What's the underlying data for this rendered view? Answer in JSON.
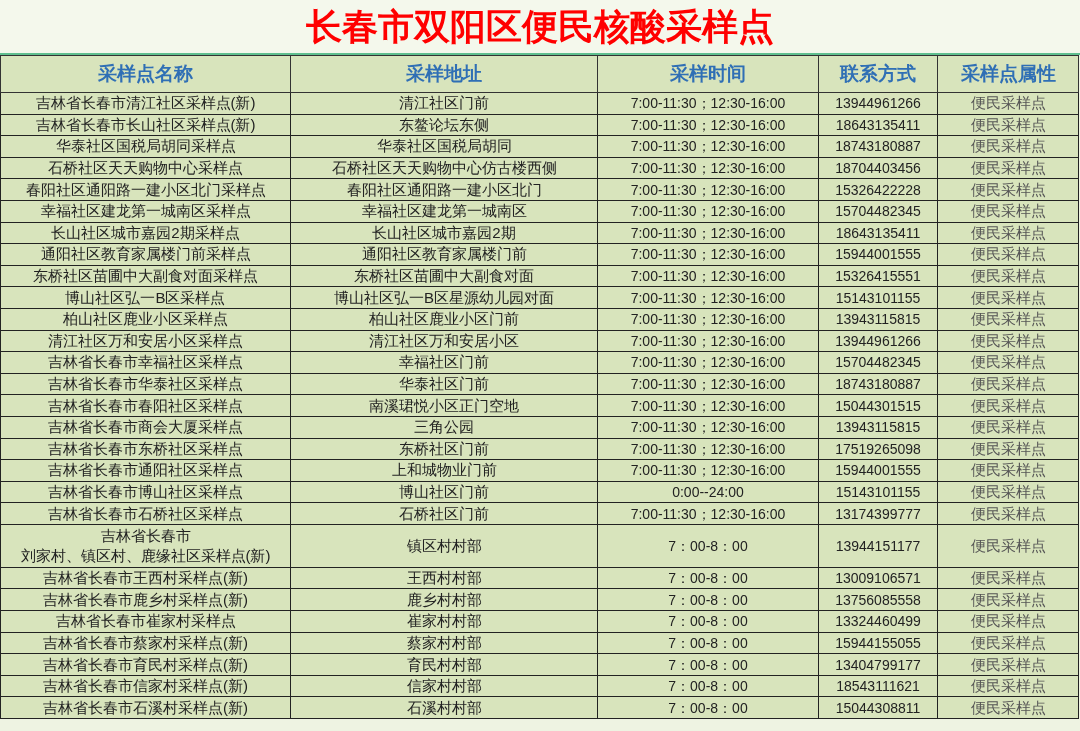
{
  "title": "长春市双阳区便民核酸采样点",
  "columns": [
    "采样点名称",
    "采样地址",
    "采样时间",
    "联系方式",
    "采样点属性"
  ],
  "rows": [
    [
      "吉林省长春市清江社区采样点(新)",
      "清江社区门前",
      "7:00-11:30；12:30-16:00",
      "13944961266",
      "便民采样点"
    ],
    [
      "吉林省长春市长山社区采样点(新)",
      "东鳌论坛东侧",
      "7:00-11:30；12:30-16:00",
      "18643135411",
      "便民采样点"
    ],
    [
      "华泰社区国税局胡同采样点",
      "华泰社区国税局胡同",
      "7:00-11:30；12:30-16:00",
      "18743180887",
      "便民采样点"
    ],
    [
      "石桥社区天天购物中心采样点",
      "石桥社区天天购物中心仿古楼西侧",
      "7:00-11:30；12:30-16:00",
      "18704403456",
      "便民采样点"
    ],
    [
      "春阳社区通阳路一建小区北门采样点",
      "春阳社区通阳路一建小区北门",
      "7:00-11:30；12:30-16:00",
      "15326422228",
      "便民采样点"
    ],
    [
      "幸福社区建龙第一城南区采样点",
      "幸福社区建龙第一城南区",
      "7:00-11:30；12:30-16:00",
      "15704482345",
      "便民采样点"
    ],
    [
      "长山社区城市嘉园2期采样点",
      "长山社区城市嘉园2期",
      "7:00-11:30；12:30-16:00",
      "18643135411",
      "便民采样点"
    ],
    [
      "通阳社区教育家属楼门前采样点",
      "通阳社区教育家属楼门前",
      "7:00-11:30；12:30-16:00",
      "15944001555",
      "便民采样点"
    ],
    [
      "东桥社区苗圃中大副食对面采样点",
      "东桥社区苗圃中大副食对面",
      "7:00-11:30；12:30-16:00",
      "15326415551",
      "便民采样点"
    ],
    [
      "博山社区弘一B区采样点",
      "博山社区弘一B区星源幼儿园对面",
      "7:00-11:30；12:30-16:00",
      "15143101155",
      "便民采样点"
    ],
    [
      "柏山社区鹿业小区采样点",
      "柏山社区鹿业小区门前",
      "7:00-11:30；12:30-16:00",
      "13943115815",
      "便民采样点"
    ],
    [
      "清江社区万和安居小区采样点",
      "清江社区万和安居小区",
      "7:00-11:30；12:30-16:00",
      "13944961266",
      "便民采样点"
    ],
    [
      "吉林省长春市幸福社区采样点",
      "幸福社区门前",
      "7:00-11:30；12:30-16:00",
      "15704482345",
      "便民采样点"
    ],
    [
      "吉林省长春市华泰社区采样点",
      "华泰社区门前",
      "7:00-11:30；12:30-16:00",
      "18743180887",
      "便民采样点"
    ],
    [
      "吉林省长春市春阳社区采样点",
      "南溪珺悦小区正门空地",
      "7:00-11:30；12:30-16:00",
      "15044301515",
      "便民采样点"
    ],
    [
      "吉林省长春市商会大厦采样点",
      "三角公园",
      "7:00-11:30；12:30-16:00",
      "13943115815",
      "便民采样点"
    ],
    [
      "吉林省长春市东桥社区采样点",
      "东桥社区门前",
      "7:00-11:30；12:30-16:00",
      "17519265098",
      "便民采样点"
    ],
    [
      "吉林省长春市通阳社区采样点",
      "上和城物业门前",
      "7:00-11:30；12:30-16:00",
      "15944001555",
      "便民采样点"
    ],
    [
      "吉林省长春市博山社区采样点",
      "博山社区门前",
      "0:00--24:00",
      "15143101155",
      "便民采样点"
    ],
    [
      "吉林省长春市石桥社区采样点",
      "石桥社区门前",
      "7:00-11:30；12:30-16:00",
      "13174399777",
      "便民采样点"
    ],
    [
      [
        "吉林省长春市",
        "刘家村、镇区村、鹿缘社区采样点(新)"
      ],
      "镇区村村部",
      "7：00-8：00",
      "13944151177",
      "便民采样点"
    ],
    [
      "吉林省长春市王西村采样点(新)",
      "王西村村部",
      "7：00-8：00",
      "13009106571",
      "便民采样点"
    ],
    [
      "吉林省长春市鹿乡村采样点(新)",
      "鹿乡村村部",
      "7：00-8：00",
      "13756085558",
      "便民采样点"
    ],
    [
      "吉林省长春市崔家村采样点",
      "崔家村村部",
      "7：00-8：00",
      "13324460499",
      "便民采样点"
    ],
    [
      "吉林省长春市蔡家村采样点(新)",
      "蔡家村村部",
      "7：00-8：00",
      "15944155055",
      "便民采样点"
    ],
    [
      "吉林省长春市育民村采样点(新)",
      "育民村村部",
      "7：00-8：00",
      "13404799177",
      "便民采样点"
    ],
    [
      "吉林省长春市信家村采样点(新)",
      "信家村村部",
      "7：00-8：00",
      "18543111621",
      "便民采样点"
    ],
    [
      "吉林省长春市石溪村采样点(新)",
      "石溪村村部",
      "7：00-8：00",
      "15044308811",
      "便民采样点"
    ]
  ]
}
